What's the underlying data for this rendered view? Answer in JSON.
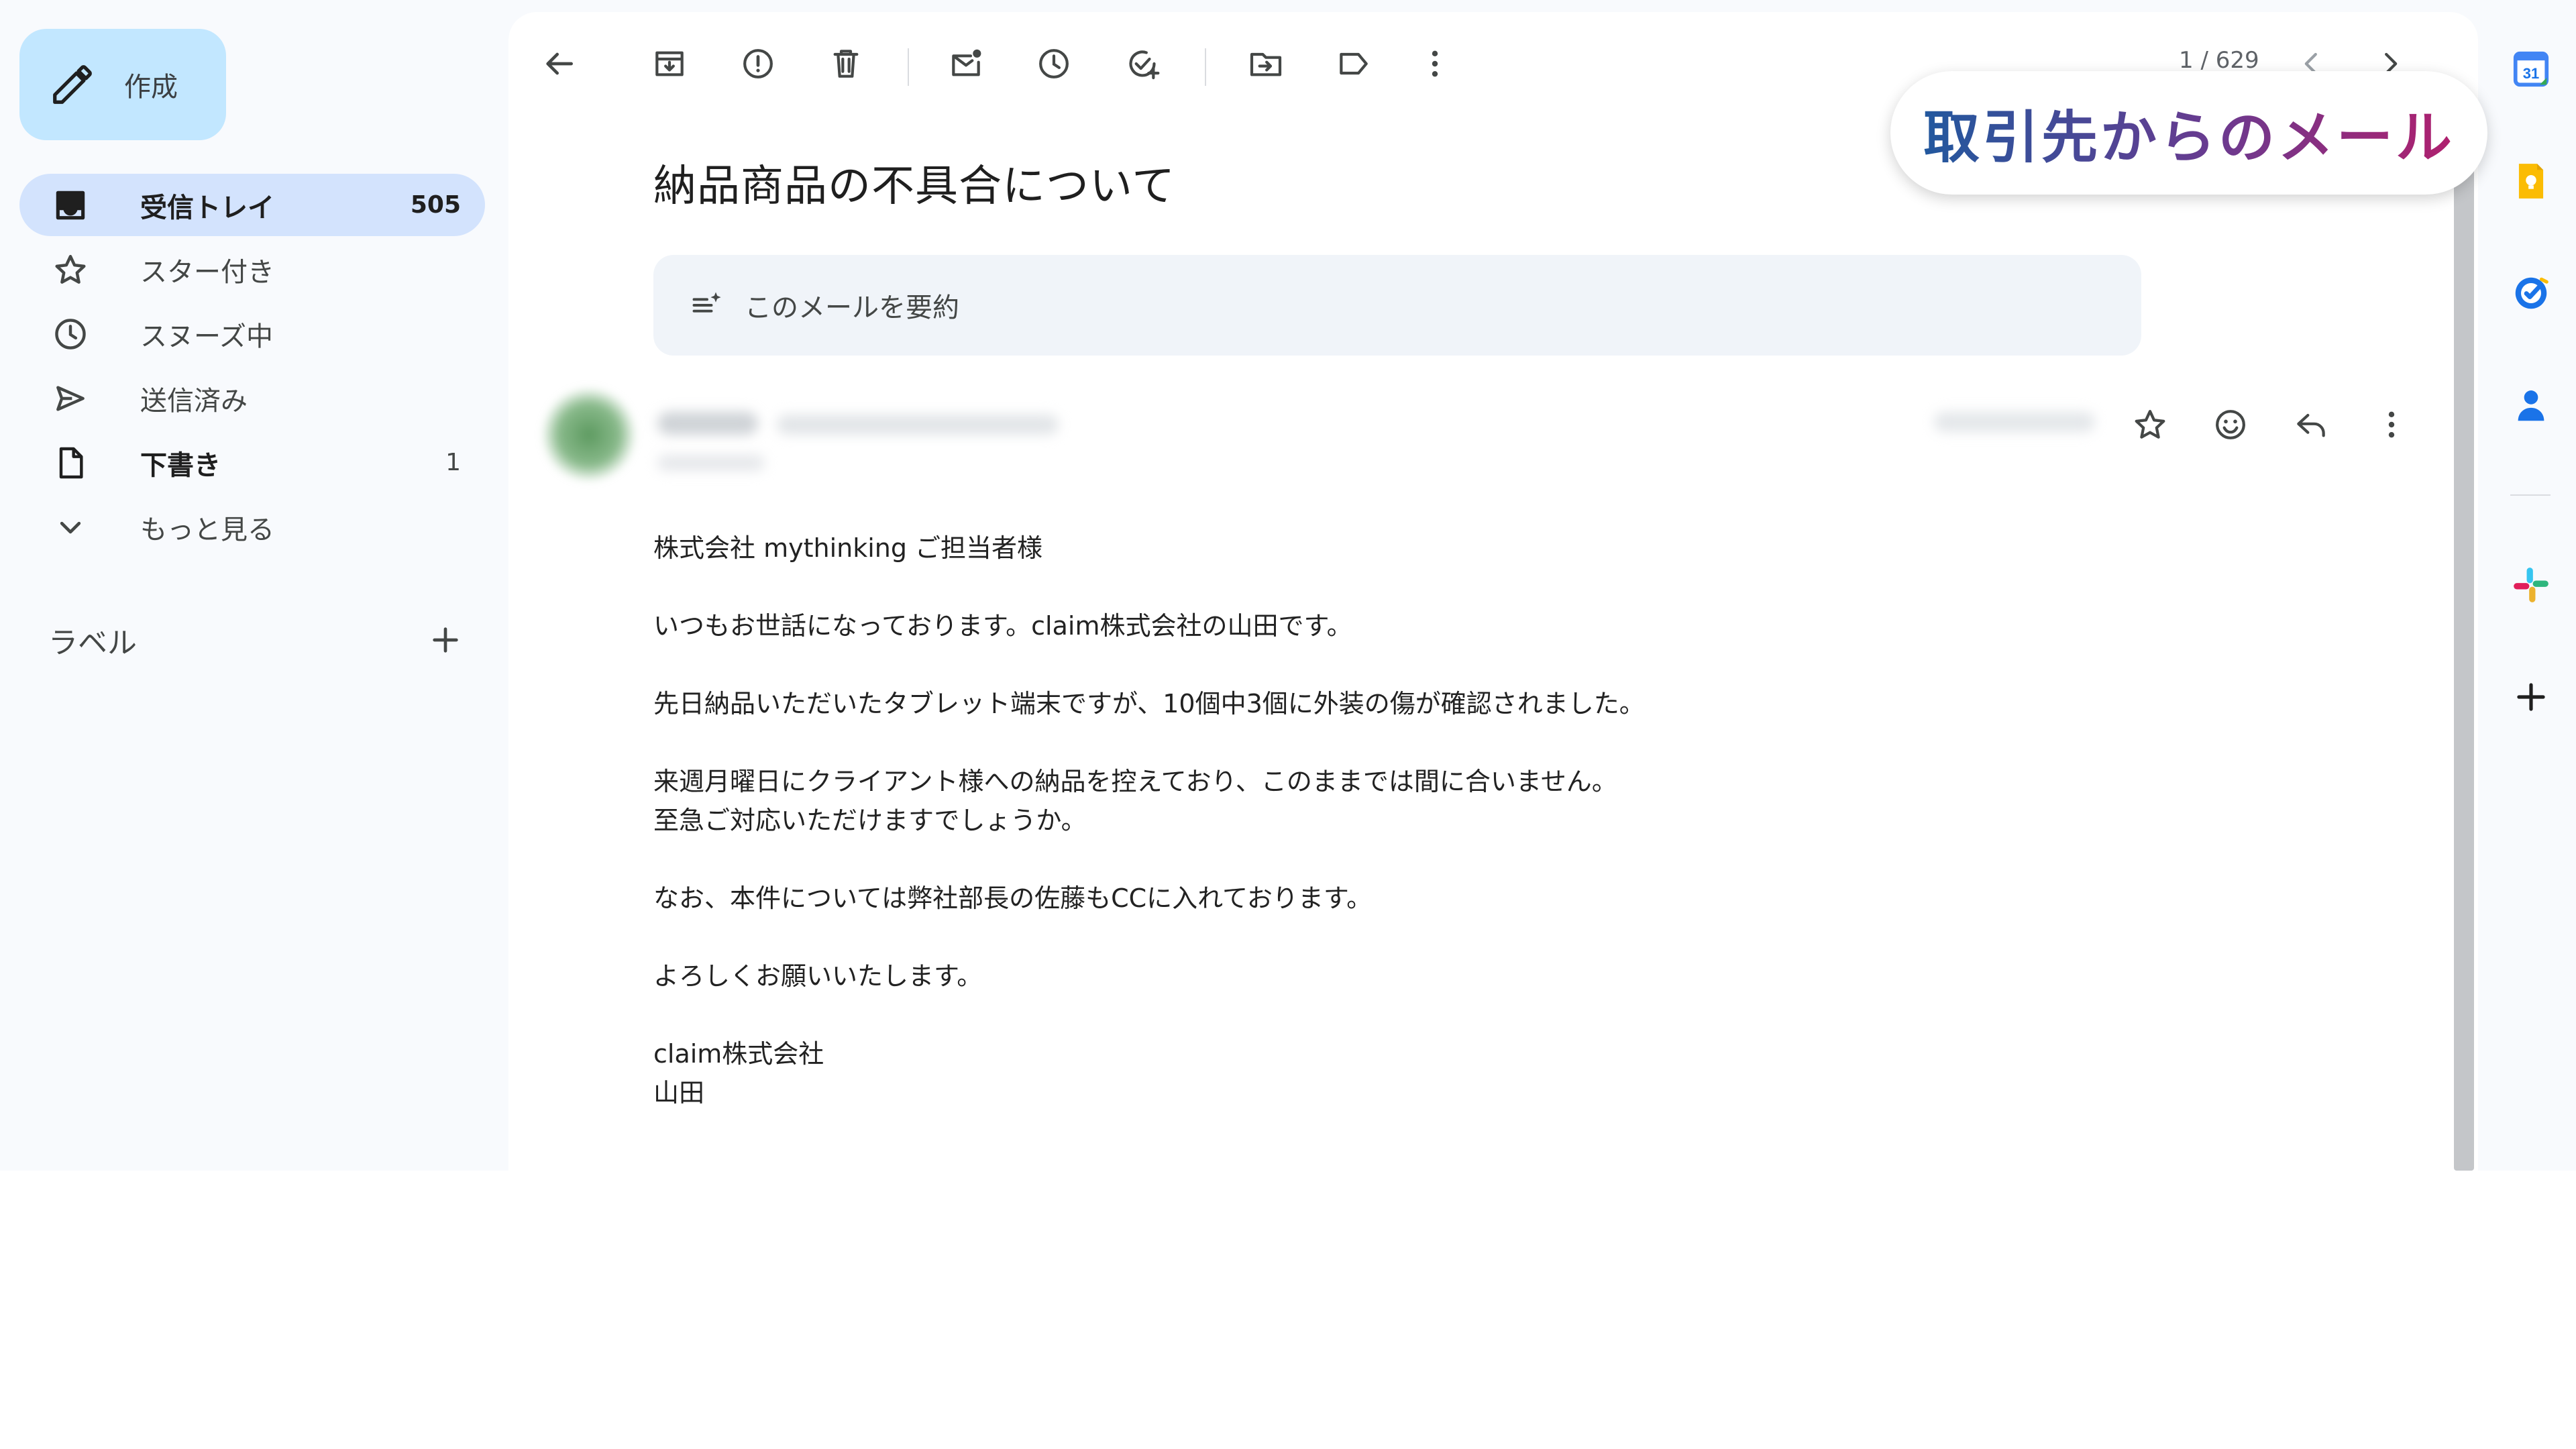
{
  "compose": {
    "label": "作成",
    "icon": "pencil-icon"
  },
  "nav": [
    {
      "label": "受信トレイ",
      "count": "505",
      "icon": "inbox-icon",
      "active": true
    },
    {
      "label": "スター付き",
      "count": "",
      "icon": "star-icon"
    },
    {
      "label": "スヌーズ中",
      "count": "",
      "icon": "clock-icon"
    },
    {
      "label": "送信済み",
      "count": "",
      "icon": "send-icon"
    },
    {
      "label": "下書き",
      "count": "1",
      "icon": "draft-icon"
    },
    {
      "label": "もっと見る",
      "count": "",
      "icon": "chevron-down-icon"
    }
  ],
  "labels": {
    "title": "ラベル",
    "icon": "plus-icon"
  },
  "toolbar": {
    "icons": [
      "back-arrow-icon",
      "archive-icon",
      "report-spam-icon",
      "delete-icon",
      "mark-unread-icon",
      "snooze-icon",
      "add-task-icon",
      "move-to-icon",
      "label-icon",
      "more-vert-icon"
    ],
    "pager": "1 / 629"
  },
  "email": {
    "subject": "納品商品の不具合について",
    "summary_label": "このメールを要約",
    "header_actions": [
      "star-icon",
      "emoji-icon",
      "reply-icon",
      "more-vert-icon"
    ],
    "body": [
      "株式会社 mythinking ご担当者様",
      "いつもお世話になっております。claim株式会社の山田です。",
      "先日納品いただいたタブレット端末ですが、10個中3個に外装の傷が確認されました。",
      "来週月曜日にクライアント様への納品を控えており、このままでは間に合いません。\n至急ご対応いただけますでしょうか。",
      "なお、本件については弊社部長の佐藤もCCに入れております。",
      "よろしくお願いいたします。",
      "claim株式会社\n山田"
    ]
  },
  "overlay": {
    "text": "取引先からのメール"
  },
  "side_panel": {
    "calendar_day": "31",
    "icons": [
      "calendar-icon",
      "keep-icon",
      "tasks-icon",
      "contacts-icon",
      "slack-icon",
      "add-addon-icon"
    ]
  },
  "colors": {
    "accent": "#c2e7ff",
    "active_nav": "#d3e3fd",
    "background": "#f8fafd"
  }
}
